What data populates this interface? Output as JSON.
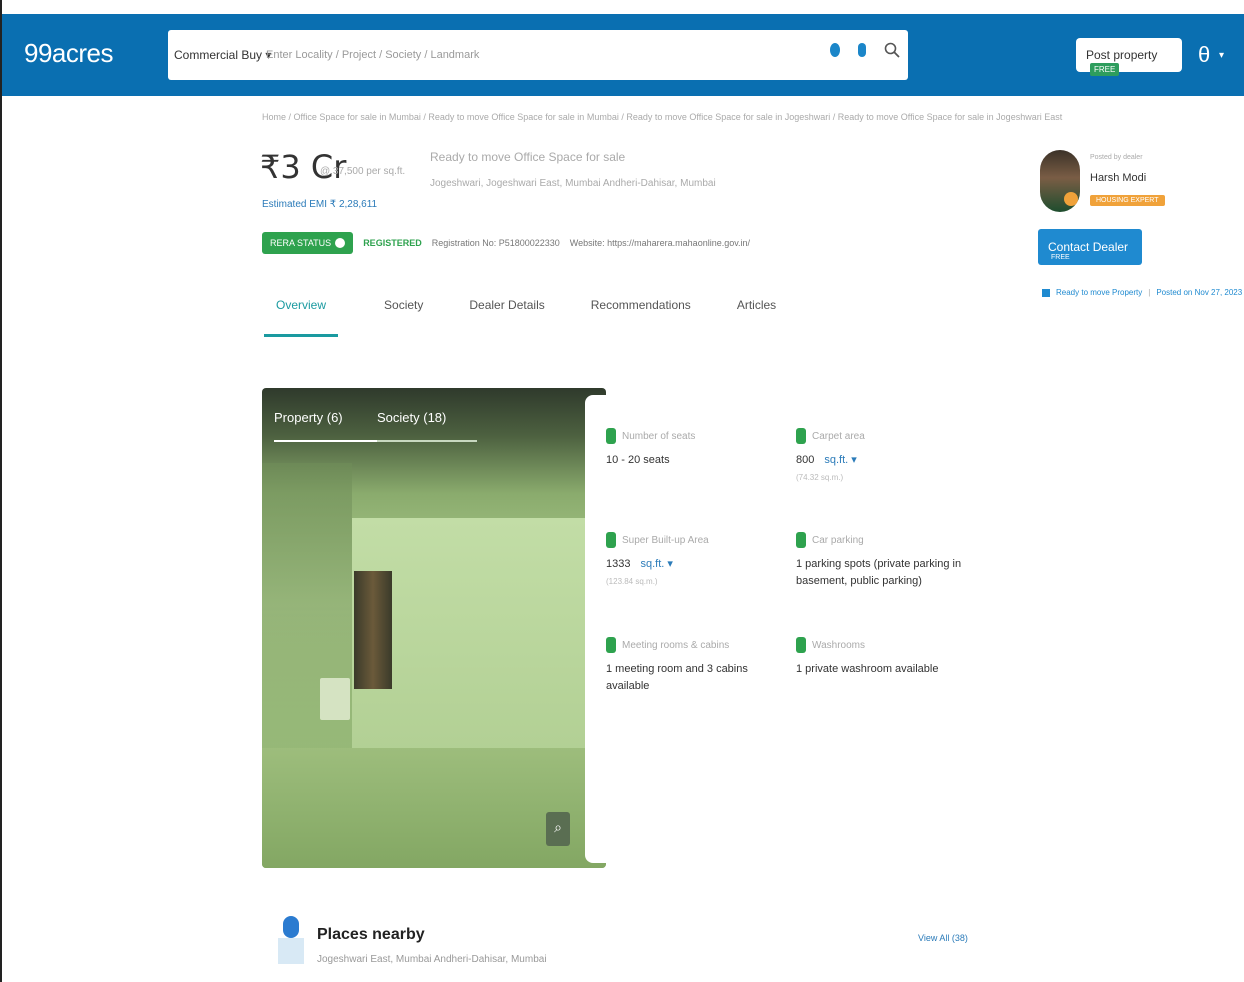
{
  "header": {
    "logo": "99acres",
    "search_type": "Commercial Buy ▾",
    "search_placeholder": "Enter Locality / Project / Society / Landmark",
    "post_property_label": "Post property",
    "post_property_badge": "FREE",
    "colors": {
      "primary": "#0a6fb1",
      "accent_green": "#2ea24e"
    }
  },
  "breadcrumb": "Home / Office Space for sale in Mumbai / Ready to move Office Space for sale in Mumbai / Ready to move Office Space for sale in Jogeshwari / Ready to move Office Space for sale in Jogeshwari East",
  "listing": {
    "price": "₹3 Cr",
    "price_per": "@ 37,500 per sq.ft.",
    "emi": "Estimated EMI ₹ 2,28,611",
    "title": "Ready to move Office Space for sale",
    "location": "Jogeshwari, Jogeshwari East, Mumbai Andheri-Dahisar, Mumbai",
    "rera_status": "RERA STATUS",
    "rera_registered": "REGISTERED",
    "registration_no": "Registration No: P51800022330",
    "website": "Website: https://maharera.mahaonline.gov.in/"
  },
  "tabs": [
    "Overview",
    "Society",
    "Dealer Details",
    "Recommendations",
    "Articles"
  ],
  "dealer": {
    "caption": "Posted by dealer",
    "name": "Harsh Modi",
    "tag": "HOUSING EXPERT",
    "contact_label": "Contact Dealer",
    "contact_badge": "FREE",
    "ready_label": "Ready to move Property",
    "posted_on": "Posted on Nov 27, 2023"
  },
  "gallery": {
    "tab_property": "Property (6)",
    "tab_society": "Society (18)"
  },
  "features": [
    {
      "label": "Number of seats",
      "value": "10 - 20 seats",
      "unit": "",
      "sub": ""
    },
    {
      "label": "Carpet area",
      "value": "800",
      "unit": "sq.ft. ▾",
      "sub": "(74.32 sq.m.)"
    },
    {
      "label": "Super Built-up Area",
      "value": "1333",
      "unit": "sq.ft. ▾",
      "sub": "(123.84 sq.m.)"
    },
    {
      "label": "Car parking",
      "value": "1 parking spots (private parking in basement, public parking)",
      "unit": "",
      "sub": ""
    },
    {
      "label": "Meeting rooms & cabins",
      "value": "1 meeting room and 3 cabins available",
      "unit": "",
      "sub": ""
    },
    {
      "label": "Washrooms",
      "value": "1 private washroom available",
      "unit": "",
      "sub": ""
    }
  ],
  "places": {
    "title": "Places nearby",
    "subtitle": "Jogeshwari East, Mumbai Andheri-Dahisar, Mumbai",
    "view_all": "View All (38)"
  }
}
